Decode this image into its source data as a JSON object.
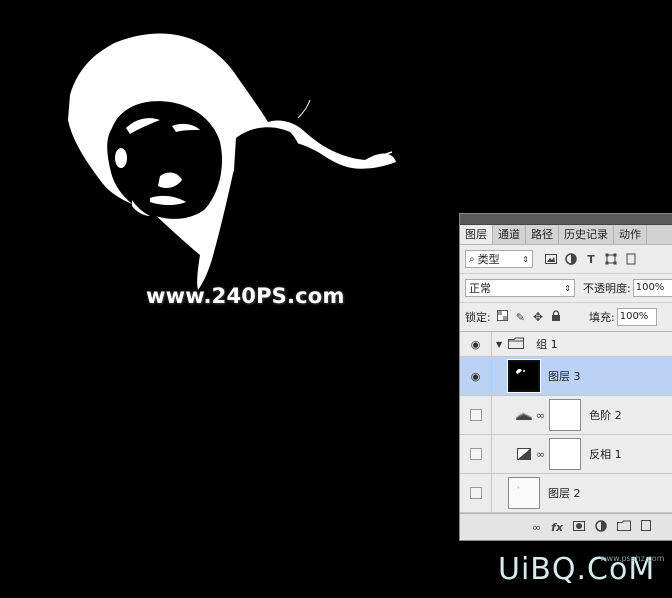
{
  "watermark": "www.240PS.com",
  "brand": {
    "logo": "UiBQ.CoM",
    "url": "www.psahz.com"
  },
  "panel": {
    "tabs": [
      "图层",
      "通道",
      "路径",
      "历史记录",
      "动作"
    ],
    "filter": {
      "label": "类型",
      "icons": [
        "image-filter-icon",
        "adjustment-filter-icon",
        "type-filter-icon",
        "shape-filter-icon",
        "smart-object-filter-icon"
      ]
    },
    "blend_mode": "正常",
    "opacity_label": "不透明度:",
    "opacity_value": "100%",
    "lock_label": "锁定:",
    "fill_label": "填充:",
    "fill_value": "100%",
    "layers": [
      {
        "name": "组 1",
        "type": "group",
        "visible": true,
        "selected": false
      },
      {
        "name": "图层 3",
        "type": "pixel",
        "visible": true,
        "selected": true
      },
      {
        "name": "色阶 2",
        "type": "levels-adjustment",
        "visible": false,
        "selected": false
      },
      {
        "name": "反相 1",
        "type": "invert-adjustment",
        "visible": false,
        "selected": false
      },
      {
        "name": "图层 2",
        "type": "pixel",
        "visible": false,
        "selected": false
      }
    ],
    "bottom_icons": [
      "link-layers-icon",
      "fx-icon",
      "add-mask-icon",
      "new-adjustment-icon",
      "new-group-icon",
      "new-layer-icon"
    ],
    "fx_label": "fx",
    "selection_color": "#bcd2f5"
  }
}
